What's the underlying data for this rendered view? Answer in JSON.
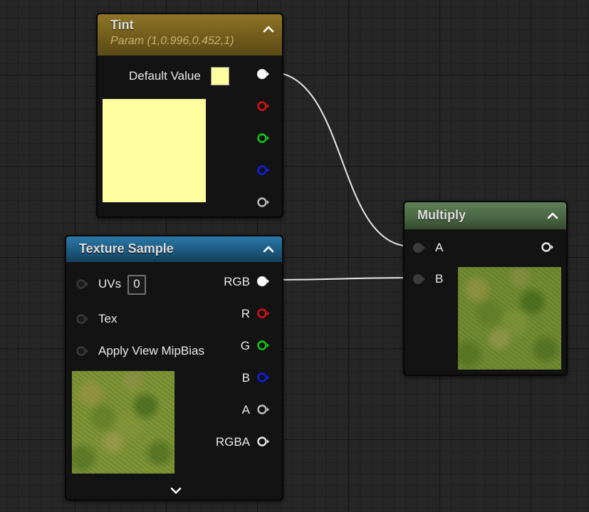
{
  "tint_node": {
    "title": "Tint",
    "subtitle": "Param (1,0.996,0.452,1)",
    "default_value_label": "Default Value",
    "color": "#fefd9f",
    "header_color": "#7a6320"
  },
  "texture_sample_node": {
    "title": "Texture Sample",
    "inputs": [
      {
        "label": "UVs",
        "value": "0"
      },
      {
        "label": "Tex"
      },
      {
        "label": "Apply View MipBias"
      }
    ],
    "outputs": [
      "RGB",
      "R",
      "G",
      "B",
      "A",
      "RGBA"
    ],
    "header_color": "#1f5f86"
  },
  "multiply_node": {
    "title": "Multiply",
    "inputs": [
      "A",
      "B"
    ],
    "header_color": "#4b6a44"
  },
  "pin_colors": {
    "white": "#ffffff",
    "red": "#e01010",
    "green": "#10d010",
    "blue": "#1020e8",
    "gray": "#bfbfbf"
  }
}
